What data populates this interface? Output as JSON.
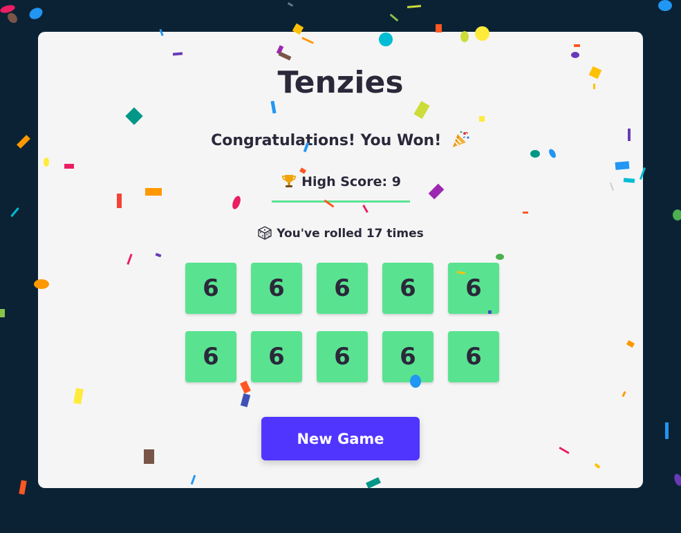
{
  "app": {
    "title": "Tenzies",
    "status_message": "Congratulations! You Won!",
    "status_icon": "party-popper-icon",
    "high_score_label": "High Score: 9",
    "high_score_icon": "trophy-icon",
    "rolls_label": "You've rolled 17 times",
    "rolls_icon": "dice-icon",
    "new_game_label": "New Game"
  },
  "dice": [
    {
      "value": "6",
      "held": true
    },
    {
      "value": "6",
      "held": true
    },
    {
      "value": "6",
      "held": true
    },
    {
      "value": "6",
      "held": true
    },
    {
      "value": "6",
      "held": true
    },
    {
      "value": "6",
      "held": true
    },
    {
      "value": "6",
      "held": true
    },
    {
      "value": "6",
      "held": true
    },
    {
      "value": "6",
      "held": true
    },
    {
      "value": "6",
      "held": true
    }
  ],
  "colors": {
    "background": "#0b2234",
    "card": "#f5f5f5",
    "text": "#2b283a",
    "die_held": "#59e391",
    "accent_line": "#59e391",
    "button": "#5035ff",
    "button_text": "#ffffff"
  },
  "decoration": {
    "confetti": true
  }
}
